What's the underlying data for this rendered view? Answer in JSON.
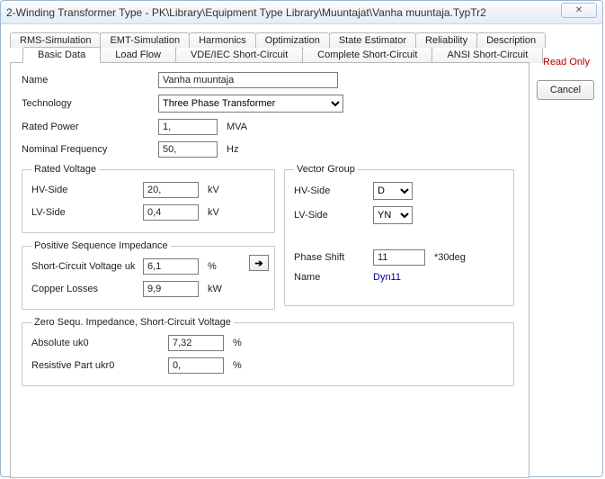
{
  "window": {
    "title": "2-Winding Transformer Type - PK\\Library\\Equipment Type Library\\Muuntajat\\Vanha muuntaja.TypTr2",
    "close_glyph": "✕"
  },
  "tabs": {
    "top": [
      "RMS-Simulation",
      "EMT-Simulation",
      "Harmonics",
      "Optimization",
      "State Estimator",
      "Reliability",
      "Description"
    ],
    "bottom": [
      "Basic Data",
      "Load Flow",
      "VDE/IEC Short-Circuit",
      "Complete Short-Circuit",
      "ANSI Short-Circuit"
    ],
    "active": "Basic Data"
  },
  "side": {
    "readonly": "Read Only",
    "cancel": "Cancel"
  },
  "form": {
    "name_label": "Name",
    "name_value": "Vanha muuntaja",
    "tech_label": "Technology",
    "tech_value": "Three Phase Transformer",
    "rated_power_label": "Rated Power",
    "rated_power_value": "1,",
    "rated_power_unit": "MVA",
    "nom_freq_label": "Nominal Frequency",
    "nom_freq_value": "50,",
    "nom_freq_unit": "Hz"
  },
  "rated_voltage": {
    "legend": "Rated Voltage",
    "hv_label": "HV-Side",
    "hv_value": "20,",
    "hv_unit": "kV",
    "lv_label": "LV-Side",
    "lv_value": "0,4",
    "lv_unit": "kV"
  },
  "vector_group": {
    "legend": "Vector Group",
    "hv_label": "HV-Side",
    "hv_value": "D",
    "lv_label": "LV-Side",
    "lv_value": "YN",
    "phase_shift_label": "Phase Shift",
    "phase_shift_value": "11",
    "phase_shift_unit": "*30deg",
    "name_label": "Name",
    "name_value": "Dyn11"
  },
  "pos_seq": {
    "legend": "Positive Sequence Impedance",
    "uk_label": "Short-Circuit Voltage uk",
    "uk_value": "6,1",
    "uk_unit": "%",
    "cu_label": "Copper Losses",
    "cu_value": "9,9",
    "cu_unit": "kW",
    "arrow": "➔"
  },
  "zero_seq": {
    "legend": "Zero Sequ. Impedance, Short-Circuit Voltage",
    "abs_label": "Absolute uk0",
    "abs_value": "7,32",
    "abs_unit": "%",
    "res_label": "Resistive Part ukr0",
    "res_value": "0,",
    "res_unit": "%"
  }
}
